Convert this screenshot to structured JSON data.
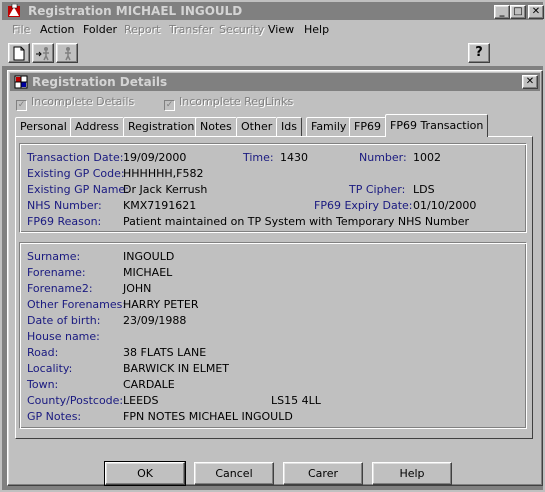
{
  "main_window": {
    "title": "Registration MICHAEL INGOULD",
    "minimize": "_",
    "maximize": "□",
    "close": "✕"
  },
  "menu": [
    {
      "label": "File",
      "enabled": false
    },
    {
      "label": "Action",
      "enabled": true
    },
    {
      "label": "Folder",
      "enabled": true
    },
    {
      "label": "Report",
      "enabled": false
    },
    {
      "label": "Transfer",
      "enabled": false
    },
    {
      "label": "Security",
      "enabled": false
    },
    {
      "label": "View",
      "enabled": true
    },
    {
      "label": "Help",
      "enabled": true
    }
  ],
  "toolbar": {
    "help_glyph": "?",
    "icons": [
      "new-document-icon",
      "person-arrow-icon",
      "person-icon",
      "help-icon"
    ]
  },
  "child_window": {
    "title": "Registration Details",
    "close": "✕",
    "checks": {
      "incomplete_details": "Incomplete Details",
      "incomplete_reglinks": "Incomplete RegLinks"
    },
    "tabs": [
      "Personal",
      "Address",
      "Registration",
      "Notes",
      "Other",
      "Ids",
      "Family",
      "FP69",
      "FP69 Transaction"
    ],
    "active_tab": "FP69 Transaction"
  },
  "transaction": {
    "date_label": "Transaction Date:",
    "date_value": "19/09/2000",
    "time_label": "Time:",
    "time_value": "1430",
    "number_label": "Number:",
    "number_value": "1002",
    "gp_code_label": "Existing GP Code:",
    "gp_code_value": "HHHHHH,F582",
    "gp_name_label": "Existing GP Name:",
    "gp_name_value": "Dr Jack Kerrush",
    "tp_cipher_label": "TP Cipher:",
    "tp_cipher_value": "LDS",
    "nhs_label": "NHS Number:",
    "nhs_value": "KMX7191621",
    "expiry_label": "FP69 Expiry Date:",
    "expiry_value": "01/10/2000",
    "reason_label": "FP69 Reason:",
    "reason_value": "Patient maintained on TP System with Temporary NHS Number"
  },
  "patient": {
    "surname_label": "Surname:",
    "surname_value": "INGOULD",
    "forename_label": "Forename:",
    "forename_value": "MICHAEL",
    "forename2_label": "Forename2:",
    "forename2_value": "JOHN",
    "other_label": "Other Forenames:",
    "other_value": "HARRY PETER",
    "dob_label": "Date of birth:",
    "dob_value": "23/09/1988",
    "house_label": "House name:",
    "house_value": "",
    "road_label": "Road:",
    "road_value": "38 FLATS LANE",
    "locality_label": "Locality:",
    "locality_value": "BARWICK IN ELMET",
    "town_label": "Town:",
    "town_value": "CARDALE",
    "county_label": "County/Postcode:",
    "county_value": "LEEDS",
    "postcode_value": "LS15 4LL",
    "gpnotes_label": "GP Notes:",
    "gpnotes_value": "FPN NOTES MICHAEL INGOULD"
  },
  "buttons": {
    "ok": "OK",
    "cancel": "Cancel",
    "carer": "Carer",
    "help": "Help"
  },
  "colors": {
    "title_inactive": "#808080",
    "face": "#c0c0c0",
    "label_blue": "#1a1a80"
  }
}
